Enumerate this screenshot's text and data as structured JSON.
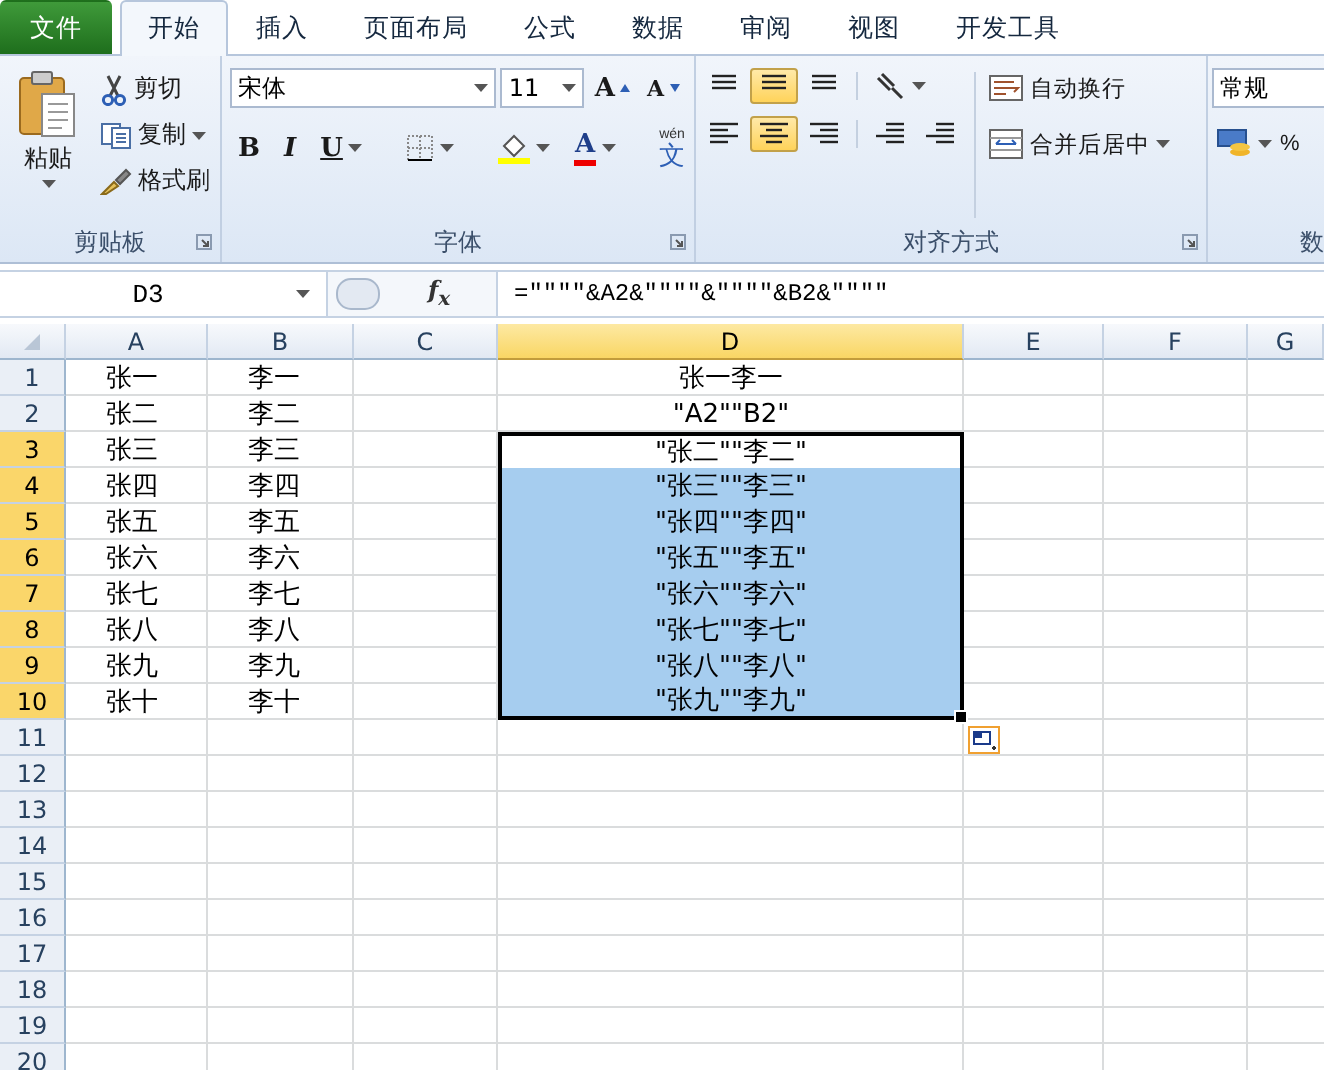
{
  "tabs": [
    {
      "label": "文件",
      "kind": "file"
    },
    {
      "label": "开始",
      "kind": "tab",
      "selected": true
    },
    {
      "label": "插入",
      "kind": "tab",
      "selected": false
    },
    {
      "label": "页面布局",
      "kind": "tab",
      "selected": false
    },
    {
      "label": "公式",
      "kind": "tab",
      "selected": false
    },
    {
      "label": "数据",
      "kind": "tab",
      "selected": false
    },
    {
      "label": "审阅",
      "kind": "tab",
      "selected": false
    },
    {
      "label": "视图",
      "kind": "tab",
      "selected": false
    },
    {
      "label": "开发工具",
      "kind": "tab",
      "selected": false
    }
  ],
  "clipboard": {
    "paste": "粘贴",
    "cut": "剪切",
    "copy": "复制",
    "format_painter": "格式刷",
    "label": "剪贴板"
  },
  "font": {
    "name": "宋体",
    "size": "11",
    "grow": "A",
    "shrink": "A",
    "bold": "B",
    "italic": "I",
    "underline": "U",
    "font_color": "A",
    "pinyin_top": "wén",
    "pinyin_main": "文",
    "label": "字体"
  },
  "alignment": {
    "middle_selected": true,
    "center_selected": true,
    "wrap": "自动换行",
    "merge": "合并后居中",
    "label": "对齐方式"
  },
  "number": {
    "format": "常规",
    "percent": "%",
    "label": "数"
  },
  "formula_bar": {
    "name_box": "D3",
    "fx": "f$_{x}$",
    "formula": "=\"\"\"\"&A2&\"\"\"\"&\"\"\"\"&B2&\"\"\"\""
  },
  "columns": [
    {
      "label": "A",
      "selected": false
    },
    {
      "label": "B",
      "selected": false
    },
    {
      "label": "C",
      "selected": false
    },
    {
      "label": "D",
      "selected": true
    },
    {
      "label": "E",
      "selected": false
    },
    {
      "label": "F",
      "selected": false
    },
    {
      "label": "G",
      "selected": false
    }
  ],
  "rows": [
    {
      "header": "1",
      "selected": false,
      "a": "张一",
      "b": "李一",
      "d": "张一李一",
      "d_selected": false
    },
    {
      "header": "2",
      "selected": false,
      "a": "张二",
      "b": "李二",
      "d": "\"A2\"\"B2\"",
      "d_selected": false
    },
    {
      "header": "3",
      "selected": true,
      "a": "张三",
      "b": "李三",
      "d": "\"张二\"\"李二\"",
      "d_selected": true,
      "d_active": true
    },
    {
      "header": "4",
      "selected": true,
      "a": "张四",
      "b": "李四",
      "d": "\"张三\"\"李三\"",
      "d_selected": true
    },
    {
      "header": "5",
      "selected": true,
      "a": "张五",
      "b": "李五",
      "d": "\"张四\"\"李四\"",
      "d_selected": true
    },
    {
      "header": "6",
      "selected": true,
      "a": "张六",
      "b": "李六",
      "d": "\"张五\"\"李五\"",
      "d_selected": true
    },
    {
      "header": "7",
      "selected": true,
      "a": "张七",
      "b": "李七",
      "d": "\"张六\"\"李六\"",
      "d_selected": true
    },
    {
      "header": "8",
      "selected": true,
      "a": "张八",
      "b": "李八",
      "d": "\"张七\"\"李七\"",
      "d_selected": true
    },
    {
      "header": "9",
      "selected": true,
      "a": "张九",
      "b": "李九",
      "d": "\"张八\"\"李八\"",
      "d_selected": true
    },
    {
      "header": "10",
      "selected": true,
      "a": "张十",
      "b": "李十",
      "d": "\"张九\"\"李九\"",
      "d_selected": true
    },
    {
      "header": "11",
      "selected": false
    },
    {
      "header": "12",
      "selected": false
    },
    {
      "header": "13",
      "selected": false
    },
    {
      "header": "14",
      "selected": false
    },
    {
      "header": "15",
      "selected": false
    },
    {
      "header": "16",
      "selected": false
    },
    {
      "header": "17",
      "selected": false
    },
    {
      "header": "18",
      "selected": false
    },
    {
      "header": "19",
      "selected": false
    },
    {
      "header": "20",
      "selected": false
    }
  ]
}
